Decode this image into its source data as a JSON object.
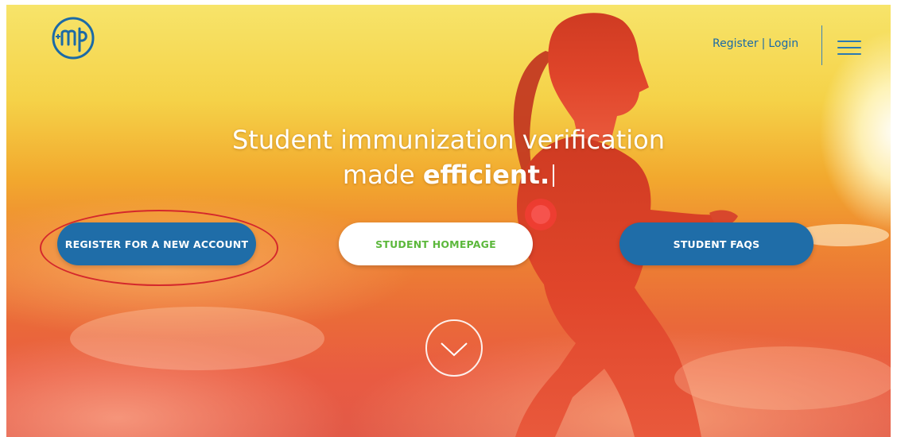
{
  "header": {
    "logo_icon": "mp-circle-logo",
    "register_label": "Register",
    "separator": "|",
    "login_label": "Login",
    "menu_icon": "hamburger-menu-icon",
    "link_color": "#1b6aa6"
  },
  "hero": {
    "headline_line1": "Student immunization verification",
    "headline_line2_prefix": "made",
    "headline_line2_emphasis": "efficient."
  },
  "buttons": {
    "register_new_account": "REGISTER FOR A NEW ACCOUNT",
    "student_homepage": "STUDENT HOMEPAGE",
    "student_faqs": "STUDENT FAQS"
  },
  "scroll": {
    "icon": "chevron-down-circle-icon"
  },
  "colors": {
    "accent_blue": "#1f6da8",
    "accent_green": "#5cb83c",
    "annotation_red": "#d4282c"
  }
}
